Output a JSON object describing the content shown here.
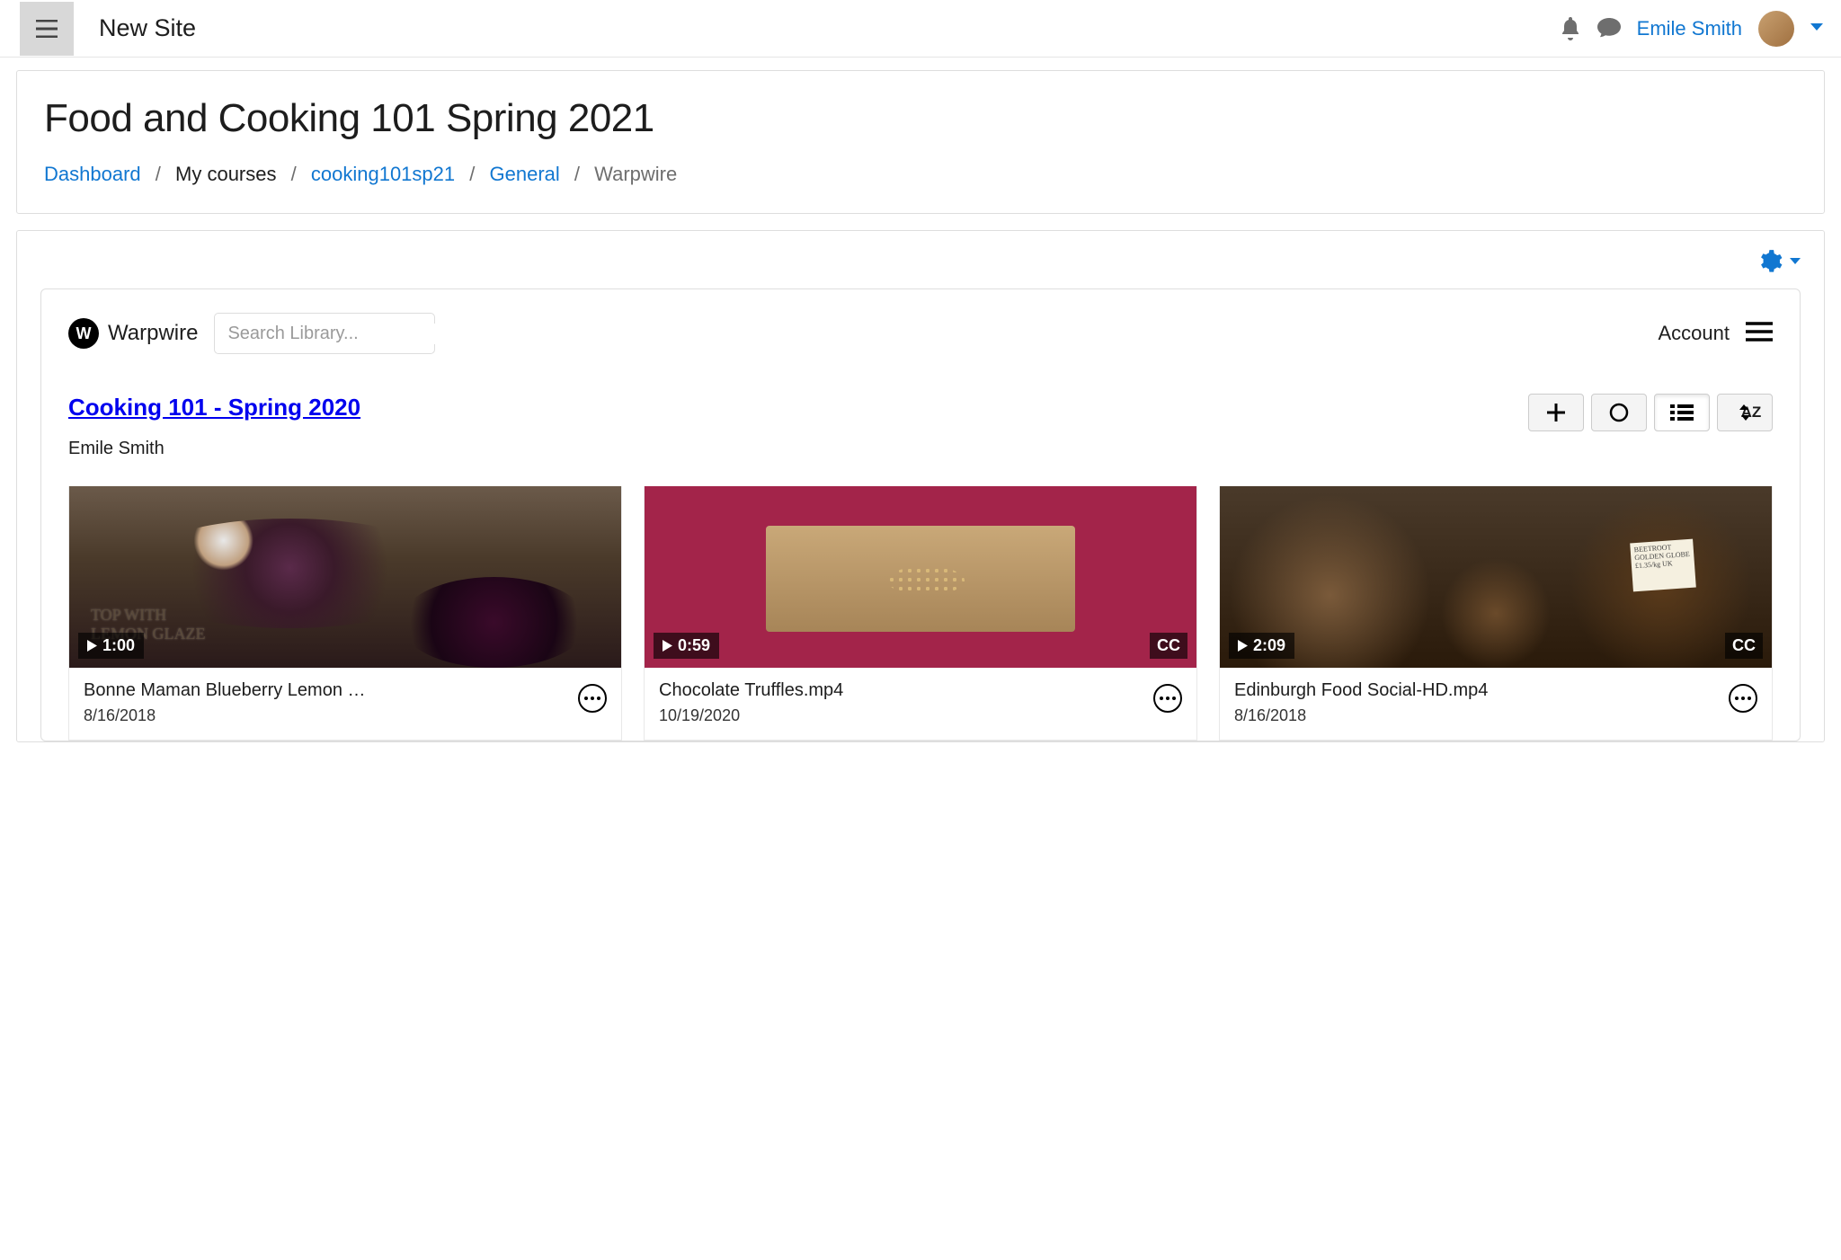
{
  "topbar": {
    "site_title": "New Site",
    "user_name": "Emile Smith"
  },
  "header": {
    "page_title": "Food and Cooking 101 Spring 2021",
    "breadcrumb": {
      "dashboard": "Dashboard",
      "my_courses": "My courses",
      "course": "cooking101sp21",
      "section": "General",
      "current": "Warpwire"
    }
  },
  "warpwire": {
    "brand": "Warpwire",
    "search_placeholder": "Search Library...",
    "account_label": "Account",
    "library_title": "Cooking 101 - Spring 2020",
    "owner": "Emile Smith",
    "sort_label": "AZ",
    "videos": [
      {
        "title": "Bonne Maman Blueberry Lemon …",
        "date": "8/16/2018",
        "duration": "1:00",
        "cc": false,
        "overlay_line1": "TOP WITH",
        "overlay_line2": "LEMON GLAZE"
      },
      {
        "title": "Chocolate Truffles.mp4",
        "date": "10/19/2020",
        "duration": "0:59",
        "cc": true
      },
      {
        "title": "Edinburgh Food Social-HD.mp4",
        "date": "8/16/2018",
        "duration": "2:09",
        "cc": true,
        "tag_text": "BEETROOT GOLDEN GLOBE £1.35/kg UK"
      }
    ]
  }
}
